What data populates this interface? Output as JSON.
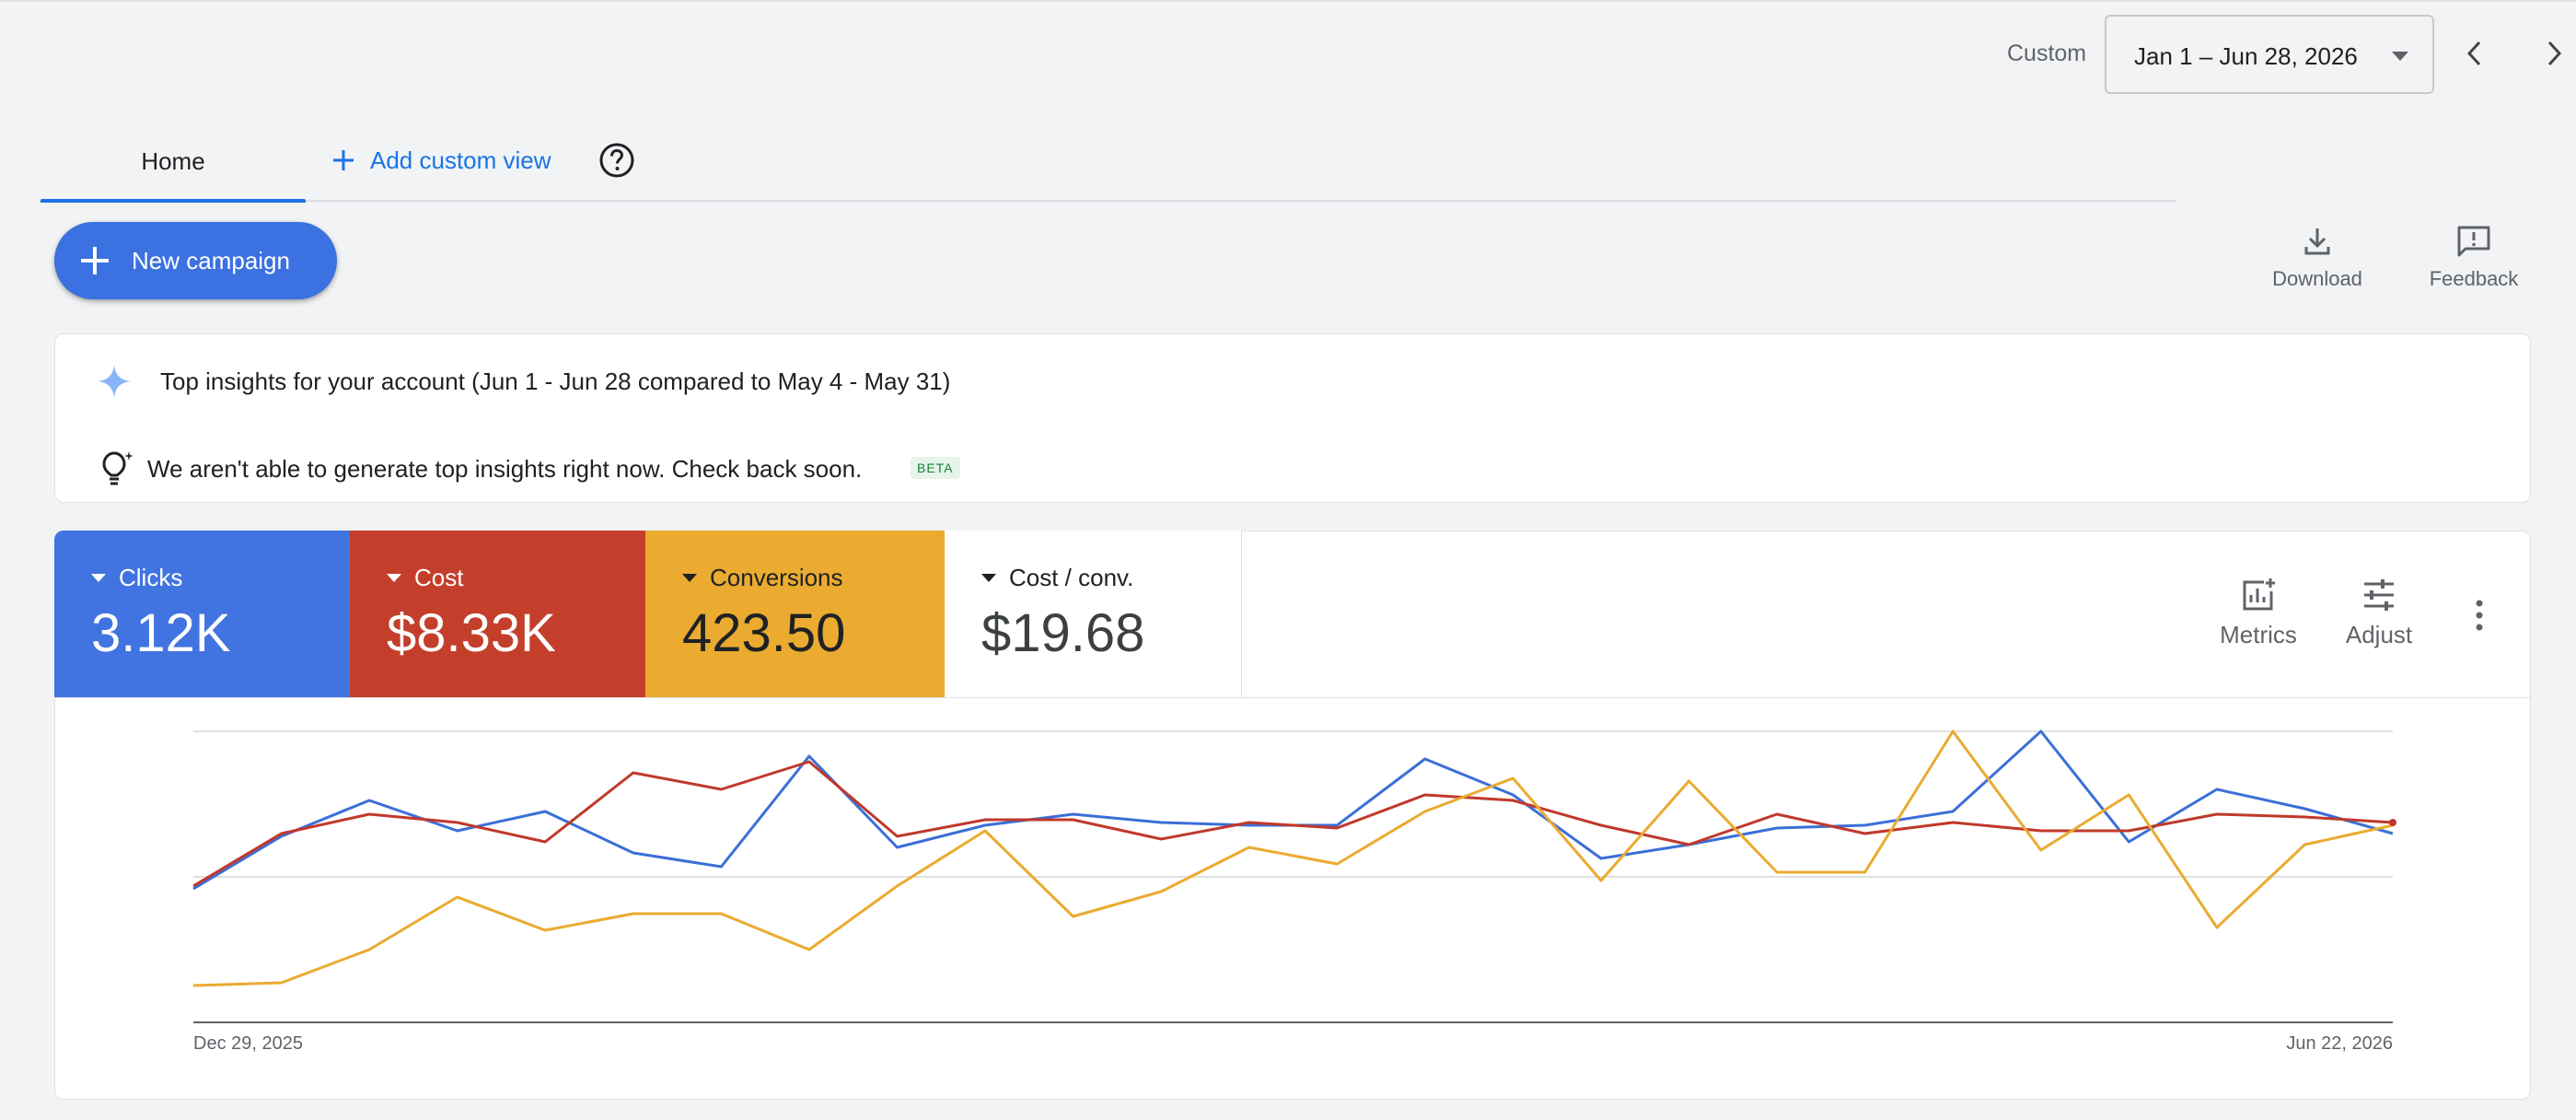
{
  "date_range": {
    "type_label": "Custom",
    "value": "Jan 1 – Jun 28, 2026"
  },
  "tabs": {
    "home": "Home",
    "add_custom_view": "Add custom view"
  },
  "actions": {
    "new_campaign": "New campaign",
    "download": "Download",
    "feedback": "Feedback"
  },
  "insights": {
    "title": "Top insights for your account (Jun 1 - Jun 28 compared to May 4 - May 31)",
    "message": "We aren't able to generate top insights right now. Check back soon.",
    "badge": "BETA"
  },
  "scorecards": [
    {
      "name": "Clicks",
      "value": "3.12K",
      "color": "#4174e0"
    },
    {
      "name": "Cost",
      "value": "$8.33K",
      "color": "#c43f2b"
    },
    {
      "name": "Conversions",
      "value": "423.50",
      "color": "#eaab30"
    },
    {
      "name": "Cost / conv.",
      "value": "$19.68",
      "color": "#ffffff"
    }
  ],
  "chart_tools": {
    "metrics": "Metrics",
    "adjust": "Adjust"
  },
  "chart_data": {
    "type": "line",
    "x_start_label": "Dec 29, 2025",
    "x_end_label": "Jun 22, 2026",
    "num_points": 26,
    "grid": true,
    "y_axis_labels_shown": false,
    "series": [
      {
        "metric": "Clicks",
        "color": "#3b6fd8",
        "values": [
          0.43,
          0.62,
          0.75,
          0.64,
          0.71,
          0.56,
          0.51,
          0.91,
          0.58,
          0.66,
          0.7,
          0.67,
          0.66,
          0.66,
          0.9,
          0.77,
          0.54,
          0.59,
          0.65,
          0.66,
          0.71,
          1.0,
          0.6,
          0.79,
          0.72,
          0.63
        ]
      },
      {
        "metric": "Cost",
        "color": "#c0392b",
        "values": [
          0.44,
          0.63,
          0.7,
          0.67,
          0.6,
          0.85,
          0.79,
          0.89,
          0.62,
          0.68,
          0.68,
          0.61,
          0.67,
          0.65,
          0.77,
          0.75,
          0.66,
          0.59,
          0.7,
          0.63,
          0.67,
          0.64,
          0.64,
          0.7,
          0.69,
          0.67
        ]
      },
      {
        "metric": "Conversions",
        "color": "#eaab30",
        "values": [
          0.08,
          0.09,
          0.21,
          0.4,
          0.28,
          0.34,
          0.34,
          0.21,
          0.44,
          0.64,
          0.33,
          0.42,
          0.58,
          0.52,
          0.71,
          0.83,
          0.46,
          0.82,
          0.49,
          0.49,
          1.0,
          0.57,
          0.77,
          0.29,
          0.59,
          0.66
        ]
      }
    ]
  }
}
